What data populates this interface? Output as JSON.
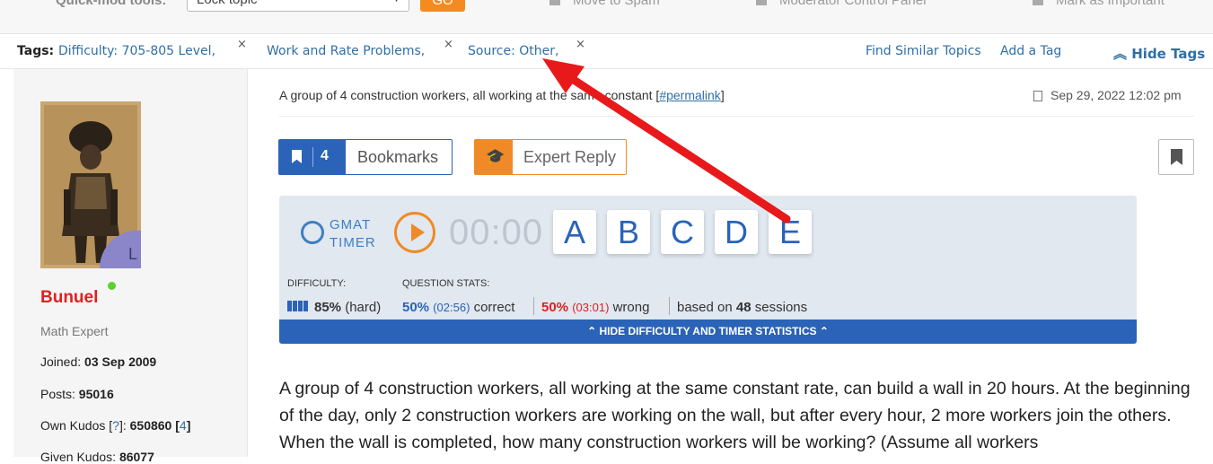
{
  "modbar": {
    "label": "Quick-mod tools:",
    "select_value": "Lock topic",
    "go_label": "GO",
    "actions": [
      "Move to Spam",
      "Moderator Control Panel",
      "Mark as Important"
    ]
  },
  "tags": {
    "label": "Tags:",
    "items": [
      "Difficulty: 705-805 Level,",
      "Work and Rate Problems,",
      "Source: Other,"
    ],
    "remove_glyph": "×",
    "find_similar": "Find Similar Topics",
    "add_tag": "Add a Tag",
    "hide_tags": "Hide Tags",
    "hide_glyph": "⌃"
  },
  "user": {
    "avatar_badge": "L",
    "name": "Bunuel",
    "role": "Math Expert",
    "joined_label": "Joined:",
    "joined_value": "03 Sep 2009",
    "posts_label": "Posts:",
    "posts_value": "95016",
    "own_kudos_label": "Own Kudos [",
    "own_kudos_help": "?",
    "own_kudos_mid": "]:",
    "own_kudos_value": "650860",
    "own_kudos_extra_open": "[",
    "own_kudos_extra": "4",
    "own_kudos_extra_close": "]",
    "given_kudos_label": "Given Kudos:",
    "given_kudos_value": "86077"
  },
  "post": {
    "title_prefix": "A group of 4 construction workers, all working at the same constant [",
    "permalink": "#permalink",
    "title_suffix": "]",
    "date": "Sep 29, 2022 12:02 pm",
    "bookmark_count": "4",
    "bookmarks_label": "Bookmarks",
    "expert_reply_label": "Expert Reply"
  },
  "timer": {
    "logo_line1": "GMAT",
    "logo_line2": "TIMER",
    "clock": "00:00",
    "answers": [
      "A",
      "B",
      "C",
      "D",
      "E"
    ],
    "difficulty_label": "DIFFICULTY:",
    "difficulty_pct": "85%",
    "difficulty_word": "(hard)",
    "stats_label": "QUESTION STATS:",
    "correct_pct": "50%",
    "correct_time": "(02:56)",
    "correct_word": "correct",
    "wrong_pct": "50%",
    "wrong_time": "(03:01)",
    "wrong_word": "wrong",
    "based_on": "based on",
    "sessions_count": "48",
    "sessions_word": "sessions",
    "hide_bar": "⌃ HIDE DIFFICULTY AND TIMER STATISTICS ⌃"
  },
  "question": {
    "text": "A group of 4 construction workers, all working at the same constant rate, can build a wall in 20 hours. At the beginning of the day, only 2 construction workers are working on the wall, but after every hour, 2 more workers join the others. When the wall is completed, how many construction workers will be working? (Assume all workers"
  },
  "colors": {
    "link": "#2f6fa6",
    "brand_blue": "#2a63b7",
    "orange": "#f08a26",
    "user_red": "#e0201f",
    "annotation_arrow": "#e8191a"
  }
}
